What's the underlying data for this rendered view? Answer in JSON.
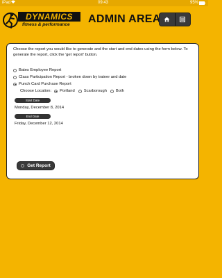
{
  "status_bar": {
    "carrier": "iPad",
    "time": "09:43",
    "battery": "95%"
  },
  "header": {
    "logo_word": "DYNAMICS",
    "logo_tagline": "fitness & performance",
    "title": "ADMIN AREA",
    "nav_icons": [
      "home-icon",
      "list-icon"
    ]
  },
  "form": {
    "intro": "Choose the report you would like to generate and the start and end dates using the form below. To generate the report, click the 'get report' button.",
    "options": [
      {
        "label": "Bates Employee Report",
        "selected": false
      },
      {
        "label": "Class Participation Report - broken down by trainer and date",
        "selected": false
      },
      {
        "label": "Punch Card Purchase Report",
        "selected": true
      }
    ],
    "location": {
      "label": "Choose Location:",
      "options": [
        {
          "label": "Portland",
          "selected": true
        },
        {
          "label": "Scarborough",
          "selected": false
        },
        {
          "label": "Both",
          "selected": false
        }
      ]
    },
    "start_date_button": "Start Date",
    "start_date_value": "Monday, December 8, 2014",
    "end_date_button": "End Date",
    "end_date_value": "Friday, December 12, 2014",
    "submit": "Get Report"
  },
  "colors": {
    "background": "#F4B400",
    "button": "#3a3a3a",
    "panel": "#ffffff"
  }
}
